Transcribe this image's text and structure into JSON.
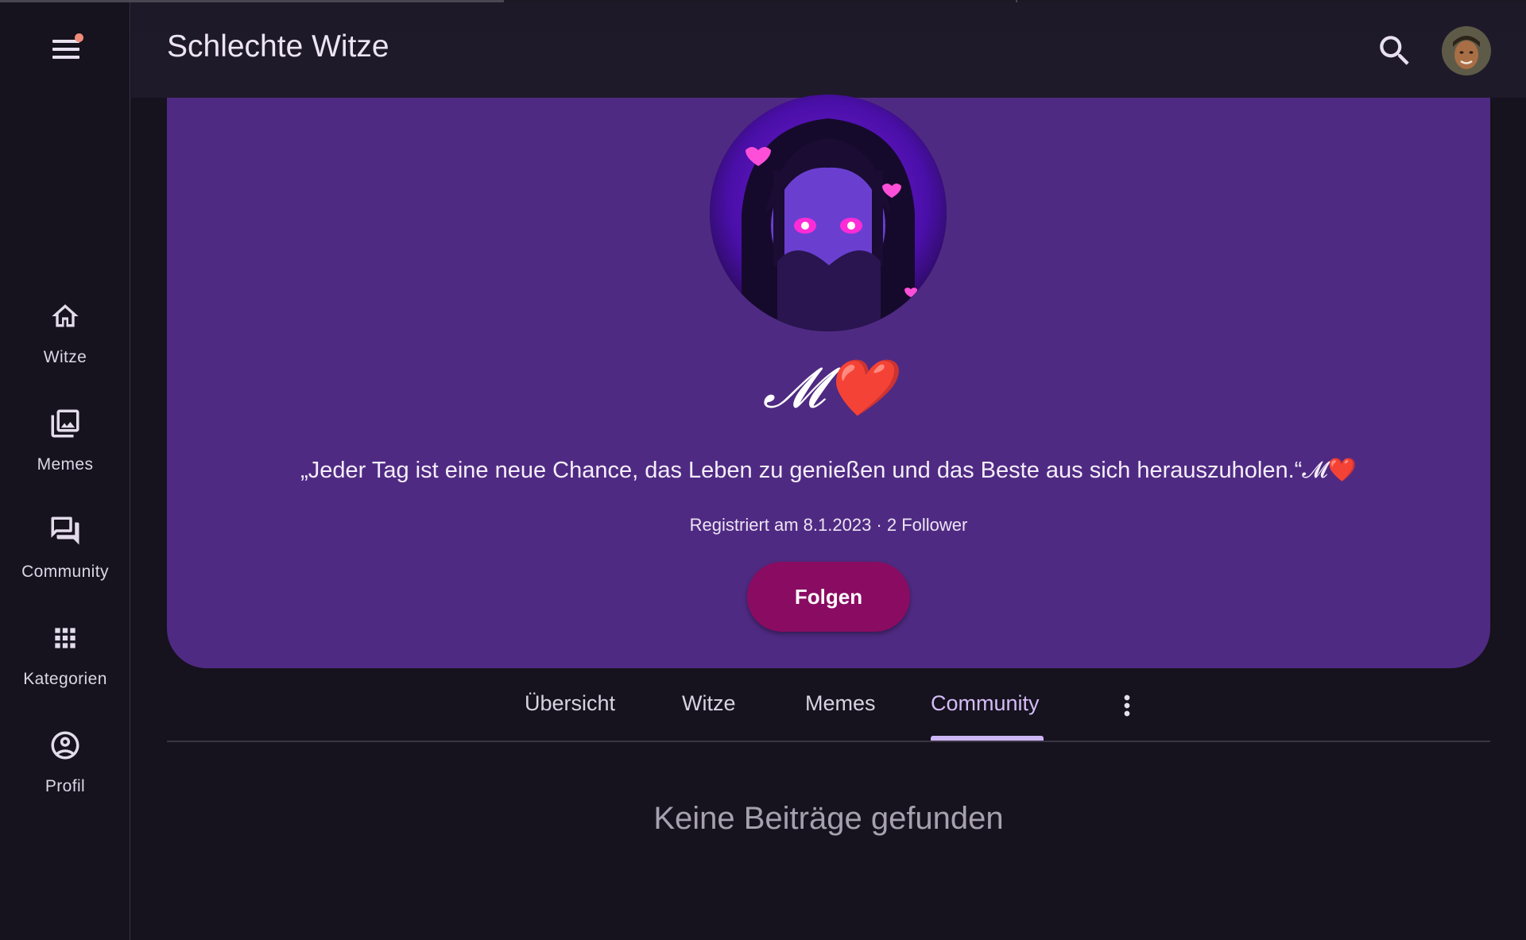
{
  "app": {
    "title": "Schlechte Witze"
  },
  "progress": {
    "value_percent": 33
  },
  "sidebar": {
    "items": [
      {
        "label": "Witze",
        "icon": "home-icon"
      },
      {
        "label": "Memes",
        "icon": "image-gallery-icon"
      },
      {
        "label": "Community",
        "icon": "forum-icon"
      },
      {
        "label": "Kategorien",
        "icon": "grid-icon"
      },
      {
        "label": "Profil",
        "icon": "account-circle-icon"
      }
    ]
  },
  "profile": {
    "name": "𝓜",
    "name_emoji": "❤️",
    "bio": "„Jeder Tag ist eine neue Chance, das Leben zu genießen und das Beste aus sich herauszuholen.“𝓜❤️",
    "meta": "Registriert am 8.1.2023 · 2 Follower",
    "follow_label": "Folgen"
  },
  "tabs": [
    {
      "label": "Übersicht"
    },
    {
      "label": "Witze"
    },
    {
      "label": "Memes"
    },
    {
      "label": "Community",
      "active": true
    }
  ],
  "empty_message": "Keine Beiträge gefunden",
  "colors": {
    "background": "#16121e",
    "card": "#4f2a82",
    "follow_button": "#8a0c62",
    "active_tab": "#d3bcf6",
    "notification_dot": "#f08b7a"
  }
}
